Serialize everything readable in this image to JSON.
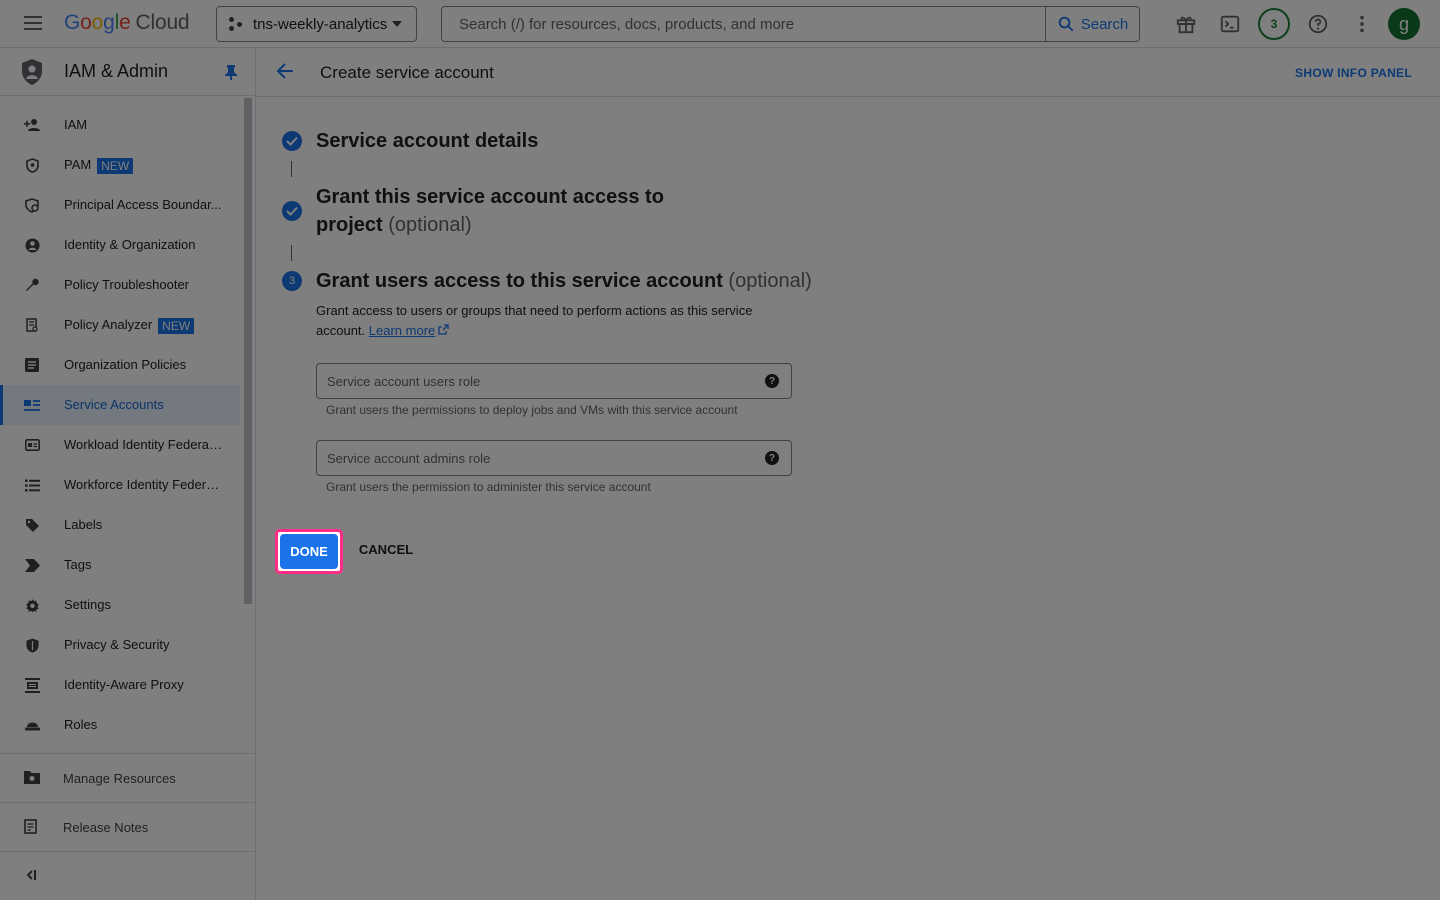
{
  "topbar": {
    "logo_letters": [
      "G",
      "o",
      "o",
      "g",
      "l",
      "e"
    ],
    "logo_product": "Cloud",
    "project": "tns-weekly-analytics",
    "search_placeholder": "Search (/) for resources, docs, products, and more",
    "search_button": "Search",
    "notification_count": "3",
    "avatar_letter": "g",
    "icons": [
      "menu-icon",
      "gift-icon",
      "cloud-shell-icon",
      "help-icon",
      "more-vert-icon"
    ]
  },
  "sidebar": {
    "title": "IAM & Admin",
    "items": [
      {
        "label": "IAM",
        "icon": "person-add-icon"
      },
      {
        "label": "PAM",
        "badge": "NEW",
        "icon": "pam-shield-icon"
      },
      {
        "label": "Principal Access Boundar...",
        "icon": "boundary-icon"
      },
      {
        "label": "Identity & Organization",
        "icon": "account-circle-icon"
      },
      {
        "label": "Policy Troubleshooter",
        "icon": "wrench-icon"
      },
      {
        "label": "Policy Analyzer",
        "badge": "NEW",
        "icon": "policy-analyzer-icon"
      },
      {
        "label": "Organization Policies",
        "icon": "list-alt-icon"
      },
      {
        "label": "Service Accounts",
        "icon": "service-account-icon",
        "active": true
      },
      {
        "label": "Workload Identity Federat...",
        "icon": "workload-id-icon"
      },
      {
        "label": "Workforce Identity Federa...",
        "icon": "list-icon"
      },
      {
        "label": "Labels",
        "icon": "label-icon"
      },
      {
        "label": "Tags",
        "icon": "tag-chevron-icon"
      },
      {
        "label": "Settings",
        "icon": "gear-icon"
      },
      {
        "label": "Privacy & Security",
        "icon": "shield-icon"
      },
      {
        "label": "Identity-Aware Proxy",
        "icon": "proxy-icon"
      },
      {
        "label": "Roles",
        "icon": "roles-icon"
      }
    ],
    "footer": {
      "manage_resources": "Manage Resources",
      "release_notes": "Release Notes",
      "collapse": "collapse-sidebar-icon"
    }
  },
  "main": {
    "title": "Create service account",
    "info_panel": "SHOW INFO PANEL",
    "steps": [
      {
        "title": "Service account details",
        "state": "complete"
      },
      {
        "title": "Grant this service account access to project",
        "optional": "(optional)",
        "state": "complete"
      },
      {
        "number": "3",
        "title": "Grant users access to this service account",
        "optional": "(optional)",
        "state": "active"
      }
    ],
    "description": "Grant access to users or groups that need to perform actions as this service account.",
    "learn_more": "Learn more",
    "fields": [
      {
        "placeholder": "Service account users role",
        "hint": "Grant users the permissions to deploy jobs and VMs with this service account"
      },
      {
        "placeholder": "Service account admins role",
        "hint": "Grant users the permission to administer this service account"
      }
    ],
    "done_label": "DONE",
    "cancel_label": "CANCEL"
  },
  "colors": {
    "accent": "#1a73e8",
    "highlight": "#ff2d87",
    "overlay": "rgba(0,0,0,0.5)"
  }
}
